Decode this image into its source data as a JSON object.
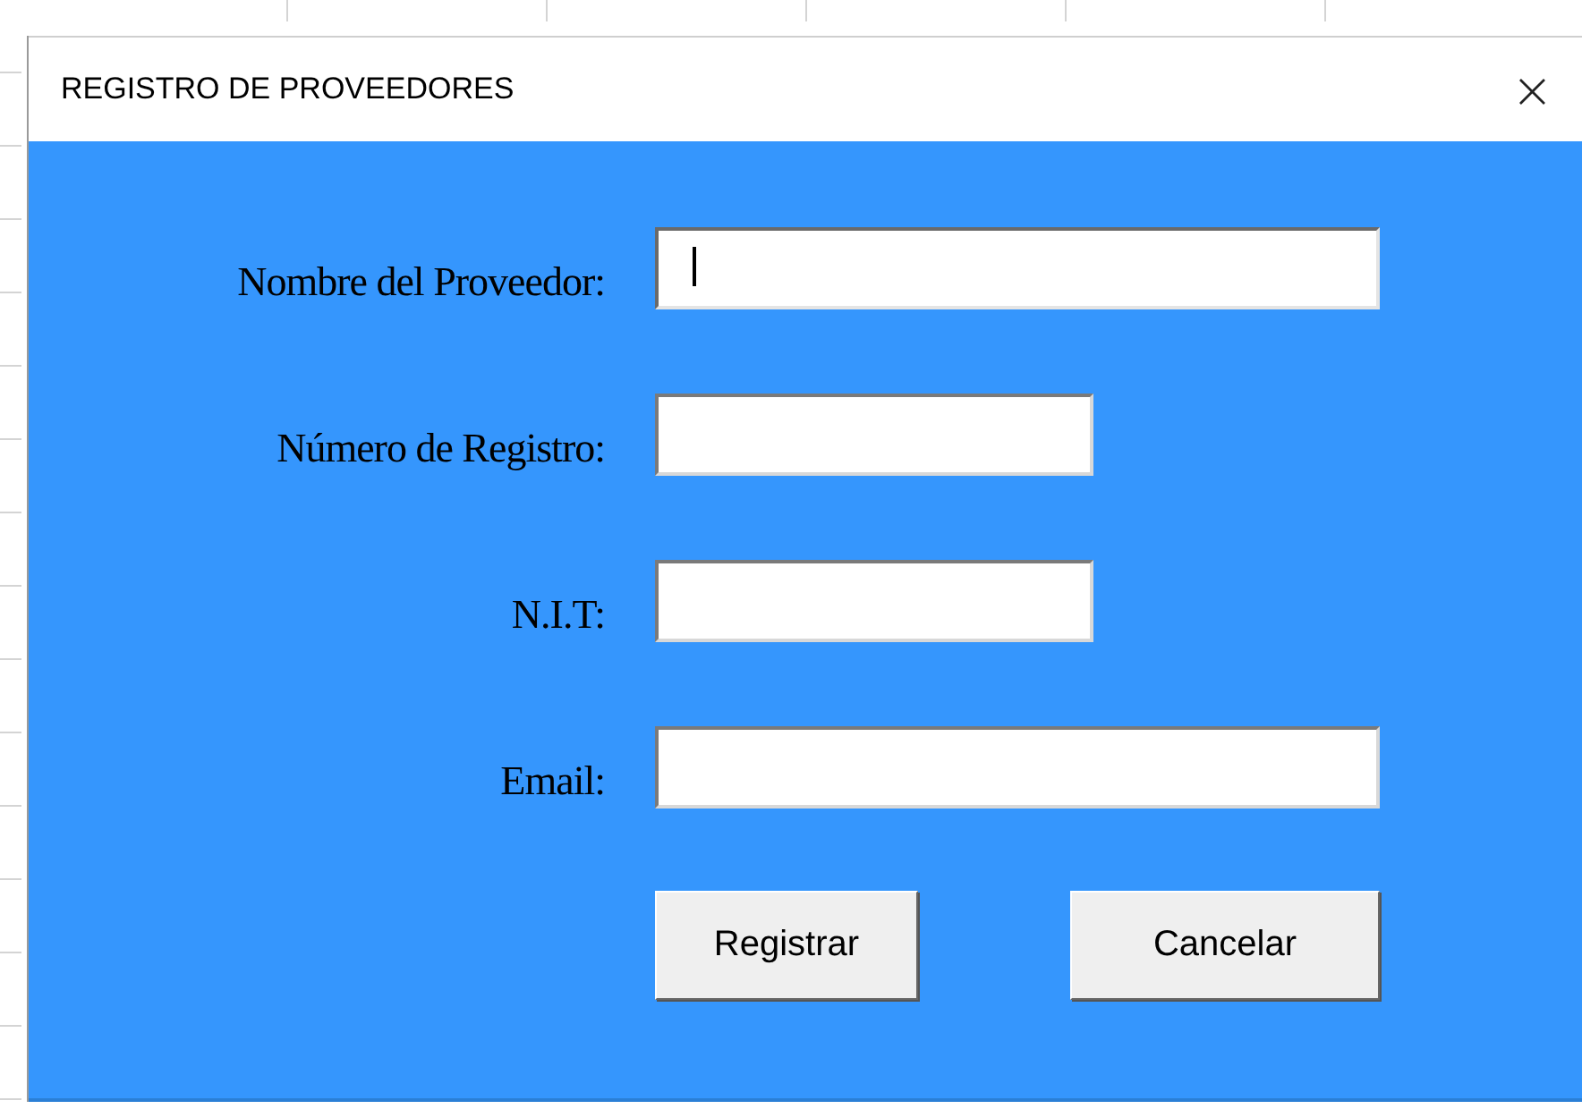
{
  "window": {
    "title": "REGISTRO DE PROVEEDORES",
    "close": "×"
  },
  "fields": [
    {
      "label": "Nombre del Proveedor:",
      "kind": "long",
      "focused": true
    },
    {
      "label": "Número de Registro:",
      "kind": "short",
      "focused": false
    },
    {
      "label": "N.I.T:",
      "kind": "short",
      "focused": false
    },
    {
      "label": "Email:",
      "kind": "long",
      "focused": false
    }
  ],
  "buttons": [
    "Registrar",
    "Cancelar"
  ]
}
